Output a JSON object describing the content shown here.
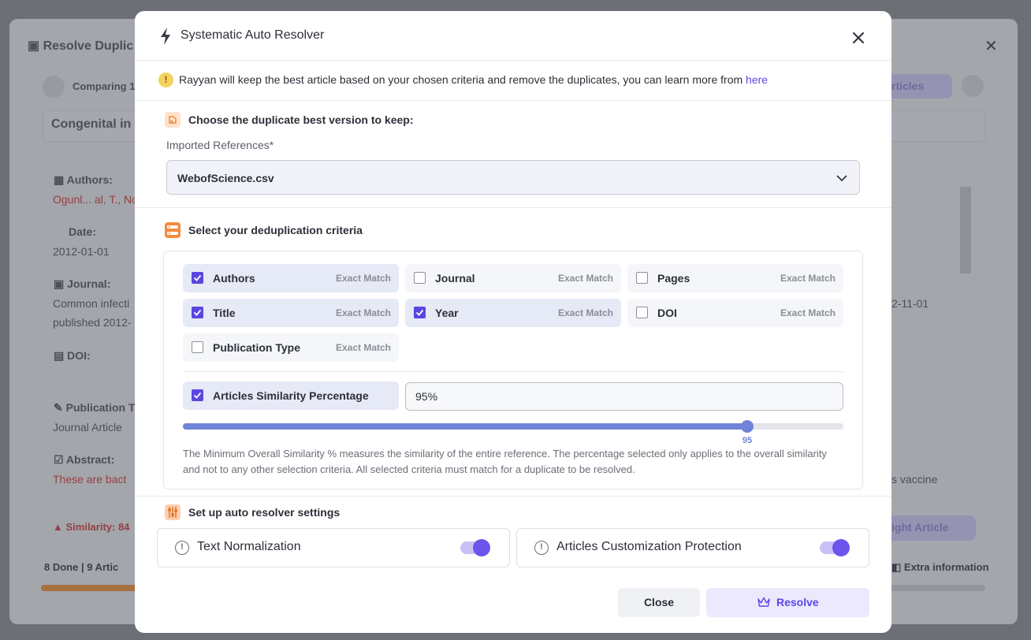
{
  "background": {
    "window_title": "Resolve Duplic",
    "comparing": "Comparing 1",
    "record_title": "Congenital in",
    "authors_label": "Authors:",
    "authors_value": "Ogunl... al, T., Not",
    "date_label": "Date:",
    "date_value": "2012-01-01",
    "journal_label": "Journal:",
    "journal_value": "Common infecti",
    "published_value": "published 2012-",
    "doi_label": "DOI:",
    "pubtype_label": "Publication T",
    "pubtype_value": "Journal Article",
    "abstract_label": "Abstract:",
    "abstract_value": "These are bact",
    "similarity_label": "Similarity: 84",
    "progress_text": "8 Done | 9 Artic",
    "articles_btn": "rticles",
    "right_date": "2-11-01",
    "right_vaccine": "s vaccine",
    "right_article_btn": "ight Article",
    "extra_info": "Extra information"
  },
  "modal": {
    "title": "Systematic Auto Resolver",
    "info_text": "Rayyan will keep the best article based on your chosen criteria and remove the duplicates, you can learn more from ",
    "info_link": "here",
    "best_version": {
      "title": "Choose the duplicate best version to keep:",
      "field_label": "Imported References*",
      "selected_value": "WebofScience.csv"
    },
    "criteria": {
      "title": "Select your deduplication criteria",
      "items": [
        {
          "label": "Authors",
          "match": "Exact Match",
          "checked": true
        },
        {
          "label": "Journal",
          "match": "Exact Match",
          "checked": false
        },
        {
          "label": "Pages",
          "match": "Exact Match",
          "checked": false
        },
        {
          "label": "Title",
          "match": "Exact Match",
          "checked": true
        },
        {
          "label": "Year",
          "match": "Exact Match",
          "checked": true
        },
        {
          "label": "DOI",
          "match": "Exact Match",
          "checked": false
        },
        {
          "label": "Publication Type",
          "match": "Exact Match",
          "checked": false
        }
      ],
      "similarity_label": "Articles Similarity Percentage",
      "similarity_checked": true,
      "similarity_value": "95%",
      "slider_value": 95,
      "slider_max": 100,
      "note": "The Minimum Overall Similarity % measures the similarity of the entire reference. The percentage selected only applies to the overall similarity and not to any other selection criteria. All selected criteria must match for a duplicate to be resolved."
    },
    "settings": {
      "title": "Set up auto resolver settings",
      "toggles": [
        {
          "label": "Text Normalization",
          "on": true
        },
        {
          "label": "Articles Customization Protection",
          "on": true
        }
      ]
    },
    "buttons": {
      "close": "Close",
      "resolve": "Resolve"
    }
  },
  "colors": {
    "accent": "#5b46e0",
    "link": "#5a47e8",
    "slider": "#6f84d9",
    "toggle_knob": "#6b55ec"
  }
}
